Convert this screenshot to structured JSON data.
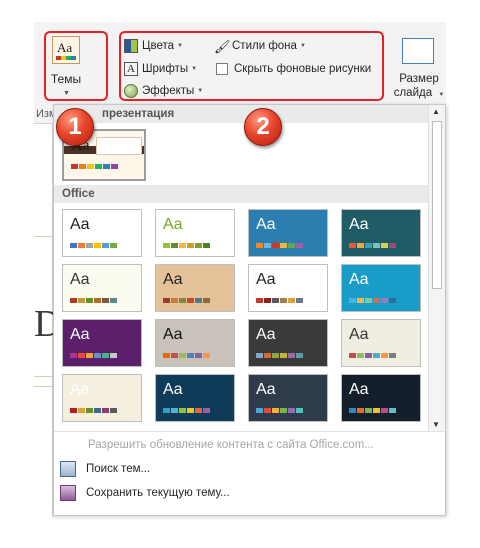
{
  "ribbon": {
    "themes_label": "Темы",
    "colors_label": "Цвета",
    "fonts_label": "Шрифты",
    "effects_label": "Эффекты",
    "bg_styles_label": "Стили фона",
    "hide_bg_label": "Скрыть фоновые рисунки",
    "slide_size_label_1": "Размер",
    "slide_size_label_2": "слайда",
    "group_label_fragment": "Изм"
  },
  "badges": {
    "one": "1",
    "two": "2"
  },
  "dropdown": {
    "this_presentation_header": "презентация",
    "office_header": "Office",
    "themes": [
      {
        "aa": "Aa",
        "bg": "#ffffff",
        "fg": "#222222",
        "palette": [
          "#4472c4",
          "#ed7d31",
          "#a5a5a5",
          "#ffc000",
          "#5b9bd5",
          "#70ad47"
        ]
      },
      {
        "aa": "Aa",
        "bg": "#ffffff",
        "fg": "#7aa529",
        "palette": [
          "#95c13d",
          "#5e8f2a",
          "#f4b942",
          "#c9a227",
          "#7a9e2a",
          "#4d7f25"
        ]
      },
      {
        "aa": "Aa",
        "bg": "#2d7eb0",
        "fg": "#ffffff",
        "palette": [
          "#f08a24",
          "#6eb4dd",
          "#d7342b",
          "#e8b84b",
          "#5ba95c",
          "#a35fab"
        ]
      },
      {
        "aa": "Aa",
        "bg": "#1f5c66",
        "fg": "#ffffff",
        "palette": [
          "#e6553a",
          "#f2a541",
          "#39a5a5",
          "#7bc0c4",
          "#d4d44e",
          "#a04a7c"
        ]
      },
      {
        "aa": "Aa",
        "bg": "#fbfbf0",
        "fg": "#333333",
        "palette": [
          "#a53c2a",
          "#c29a3a",
          "#6b8e23",
          "#b36b2d",
          "#7a5c3a",
          "#5b8a8a"
        ]
      },
      {
        "aa": "Aa",
        "bg": "#e5c39a",
        "fg": "#222222",
        "palette": [
          "#9e3a29",
          "#c97c35",
          "#7c8c3a",
          "#c44a2c",
          "#4a7a8c",
          "#8c6a3a"
        ]
      },
      {
        "aa": "Aa",
        "bg": "#ffffff",
        "fg": "#222222",
        "palette": [
          "#c0392b",
          "#8e1f1a",
          "#5a5a5a",
          "#a57b4e",
          "#d8a23c",
          "#6b7a8f"
        ]
      },
      {
        "aa": "Aa",
        "bg": "#1a9cc9",
        "fg": "#ffffff",
        "palette": [
          "#4ab4e0",
          "#f6b94c",
          "#7dc9a2",
          "#d36a5a",
          "#9d79b8",
          "#2e6f9e"
        ]
      },
      {
        "aa": "Aa",
        "bg": "#5c1f6b",
        "fg": "#ffffff",
        "palette": [
          "#a13a8a",
          "#e94b3c",
          "#f0a43c",
          "#6a8fc6",
          "#4caf8e",
          "#c7c7c7"
        ]
      },
      {
        "aa": "Aa",
        "bg": "#c8c2ba",
        "fg": "#111111",
        "palette": [
          "#e36c0a",
          "#c0504d",
          "#9bbb59",
          "#4f81bd",
          "#8064a2",
          "#f79646"
        ]
      },
      {
        "aa": "Aa",
        "bg": "#3a3a3a",
        "fg": "#ffffff",
        "palette": [
          "#7fa8c9",
          "#d36b3a",
          "#8aa84a",
          "#c9b03a",
          "#9b6aa8",
          "#5b9e9e"
        ]
      },
      {
        "aa": "Aa",
        "bg": "#f0ede3",
        "fg": "#333333",
        "palette": [
          "#c0504d",
          "#9bbb59",
          "#8064a2",
          "#4bacc6",
          "#f79646",
          "#7f7f7f"
        ]
      },
      {
        "aa": "Aa",
        "bg": "#f5efe0",
        "fg": "#ffffff",
        "palette": [
          "#b01e1e",
          "#d6a33a",
          "#6b8e23",
          "#3a6b8c",
          "#8c3a6b",
          "#5a5a5a"
        ]
      },
      {
        "aa": "Aa",
        "bg": "#0f3b58",
        "fg": "#ffffff",
        "palette": [
          "#2f9fd0",
          "#52b6c9",
          "#8cc63e",
          "#f2c230",
          "#e2673a",
          "#9a5fa8"
        ]
      },
      {
        "aa": "Aa",
        "bg": "#2e3b4a",
        "fg": "#ffffff",
        "palette": [
          "#4aa8d8",
          "#e24a3a",
          "#f1b13a",
          "#7ab648",
          "#9d6ab5",
          "#50c4b8"
        ]
      },
      {
        "aa": "Aa",
        "bg": "#141f2b",
        "fg": "#ffffff",
        "palette": [
          "#2e8bc0",
          "#e86a2a",
          "#7ab648",
          "#f2c230",
          "#c04a8a",
          "#5ac4c4"
        ]
      }
    ],
    "current_theme": {
      "aa": "Aa",
      "palette": [
        "#c0392b",
        "#e67e22",
        "#f1c40f",
        "#27ae60",
        "#2980b9",
        "#8e44ad"
      ]
    },
    "footer": {
      "update_label": "Разрешить обновление контента с сайта Office.com...",
      "search_label": "Поиск тем...",
      "save_label": "Сохранить текущую тему..."
    }
  },
  "colors": {
    "annotation_red": "#e8202a",
    "badge_red": "#d9351e"
  }
}
